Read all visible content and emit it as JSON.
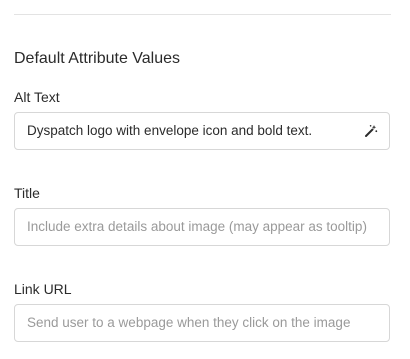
{
  "section": {
    "title": "Default Attribute Values"
  },
  "fields": [
    {
      "label": "Alt Text",
      "value": "Dyspatch logo with envelope icon and bold text.",
      "placeholder": "",
      "icon": "magic-wand-icon"
    },
    {
      "label": "Title",
      "value": "",
      "placeholder": "Include extra details about image (may appear as tooltip)"
    },
    {
      "label": "Link URL",
      "value": "",
      "placeholder": "Send user to a webpage when they click on the image"
    }
  ]
}
